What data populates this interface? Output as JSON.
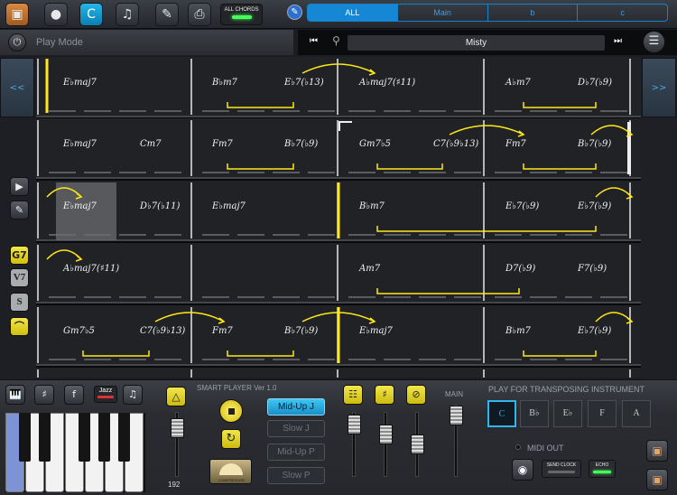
{
  "toolbar": {
    "icons": [
      "folder-icon",
      "pin-icon",
      "chord-c-icon",
      "music-note-icon",
      "edit-icon",
      "print-icon"
    ],
    "active_label": "C",
    "all_chords_label": "ALL CHORDS"
  },
  "section_tabs": [
    "ALL",
    "Main",
    "b",
    "c"
  ],
  "mode_bar": {
    "label": "Play Mode"
  },
  "song": {
    "title": "Misty"
  },
  "nav": {
    "prev": "<<",
    "next": ">>"
  },
  "left_tools": {
    "g7": "G7",
    "v7": "V7",
    "s": "S"
  },
  "chart_data": {
    "type": "table",
    "rows": [
      [
        "E♭maj7",
        "",
        "B♭m7 E♭7(♭9)",
        "A♭maj7(♯11)",
        "A♭m7 D♭7(♭9)"
      ],
      [
        "E♭maj7 Cm7",
        "Fm7 B♭7(♭9)",
        "Gm7♭5 C7(♭9♭13)",
        "Fm7 B♭7(♭9)"
      ],
      [
        "E♭maj7 D♭7(♭11)",
        "E♭maj7",
        "B♭m7",
        "E♭7(♭9) E♭7(♭9)"
      ],
      [
        "A♭maj7(♯11)",
        "",
        "Am7",
        "D7(♭9) F7(♭9)"
      ],
      [
        "Gm7♭5 C7(♭9♭13)",
        "Fm7 B♭7(♭9)",
        "E♭maj7",
        "B♭m7 E♭7(♭9)"
      ]
    ]
  },
  "chords": [
    {
      "row": 0,
      "col": 0,
      "text": "E♭maj7"
    },
    {
      "row": 0,
      "col": 2,
      "text": "B♭m7"
    },
    {
      "row": 0,
      "col": 3,
      "text": "E♭7(♭13)"
    },
    {
      "row": 0,
      "col": 4,
      "text": "A♭maj7(♯11)"
    },
    {
      "row": 0,
      "col": 6,
      "text": "A♭m7"
    },
    {
      "row": 0,
      "col": 7,
      "text": "D♭7(♭9)"
    },
    {
      "row": 1,
      "col": 0,
      "text": "E♭maj7"
    },
    {
      "row": 1,
      "col": 1,
      "text": "Cm7"
    },
    {
      "row": 1,
      "col": 2,
      "text": "Fm7"
    },
    {
      "row": 1,
      "col": 3,
      "text": "B♭7(♭9)"
    },
    {
      "row": 1,
      "col": 4,
      "text": "Gm7♭5"
    },
    {
      "row": 1,
      "col": 5,
      "text": "C7(♭9♭13)"
    },
    {
      "row": 1,
      "col": 6,
      "text": "Fm7"
    },
    {
      "row": 1,
      "col": 7,
      "text": "B♭7(♭9)"
    },
    {
      "row": 2,
      "col": 0,
      "text": "E♭maj7"
    },
    {
      "row": 2,
      "col": 1,
      "text": "D♭7(♭11)"
    },
    {
      "row": 2,
      "col": 2,
      "text": "E♭maj7"
    },
    {
      "row": 2,
      "col": 4,
      "text": "B♭m7"
    },
    {
      "row": 2,
      "col": 6,
      "text": "E♭7(♭9)"
    },
    {
      "row": 2,
      "col": 7,
      "text": "E♭7(♭9)"
    },
    {
      "row": 3,
      "col": 0,
      "text": "A♭maj7(♯11)"
    },
    {
      "row": 3,
      "col": 4,
      "text": "Am7"
    },
    {
      "row": 3,
      "col": 6,
      "text": "D7(♭9)"
    },
    {
      "row": 3,
      "col": 7,
      "text": "F7(♭9)"
    },
    {
      "row": 4,
      "col": 0,
      "text": "Gm7♭5"
    },
    {
      "row": 4,
      "col": 1,
      "text": "C7(♭9♭13)"
    },
    {
      "row": 4,
      "col": 2,
      "text": "Fm7"
    },
    {
      "row": 4,
      "col": 3,
      "text": "B♭7(♭9)"
    },
    {
      "row": 4,
      "col": 4,
      "text": "E♭maj7"
    },
    {
      "row": 4,
      "col": 6,
      "text": "B♭m7"
    },
    {
      "row": 4,
      "col": 7,
      "text": "E♭7(♭9)"
    }
  ],
  "bottom": {
    "jazz_label": "Jazz",
    "tempo": "192",
    "smart_player_title": "SMART PLAYER Ver 1.0",
    "compressor_label": "COMPRESSOR",
    "styles": [
      "Mid-Up J",
      "Slow J",
      "Mid-Up P",
      "Slow P"
    ],
    "selected_style": "Mid-Up J",
    "main_label": "MAIN",
    "transpose_title": "PLAY FOR TRANSPOSING INSTRUMENT",
    "transpose_keys": [
      "C",
      "B♭",
      "E♭",
      "F",
      "A"
    ],
    "selected_key": "C",
    "midi_out_label": "MIDI OUT",
    "send_clock_label": "SEND CLOCK",
    "echo_label": "ECHO"
  },
  "colors": {
    "accent_blue": "#1587d4",
    "chord_yellow": "#ffe81a",
    "highlight_cell": "#6a6c70"
  }
}
